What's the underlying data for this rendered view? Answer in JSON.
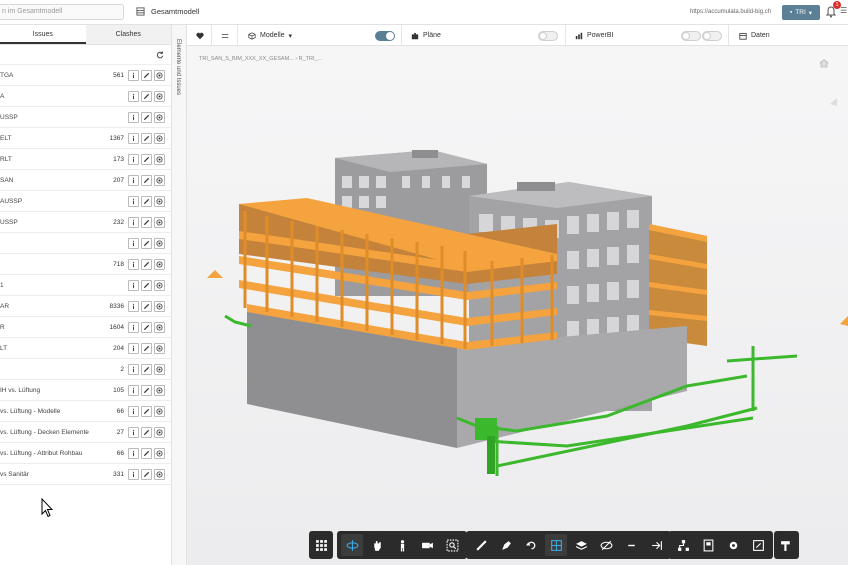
{
  "topbar": {
    "search_placeholder": "n im Gesamtmodell",
    "model_title": "Gesamtmodell",
    "url": "https://accumulata.build-big.ch",
    "user_label": "TRI",
    "notification_count": "1"
  },
  "left_panel": {
    "tabs": [
      {
        "label": "Issues",
        "active": true
      },
      {
        "label": "Clashes",
        "active": false
      }
    ],
    "rows": [
      {
        "label": "TGA",
        "count": "561"
      },
      {
        "label": "A",
        "count": ""
      },
      {
        "label": "USSP",
        "count": ""
      },
      {
        "label": "ELT",
        "count": "1367"
      },
      {
        "label": "RLT",
        "count": "173"
      },
      {
        "label": "SAN",
        "count": "207"
      },
      {
        "label": "AUSSP",
        "count": ""
      },
      {
        "label": "USSP",
        "count": "232"
      },
      {
        "label": "",
        "count": ""
      },
      {
        "label": "",
        "count": "718"
      },
      {
        "label": "1",
        "count": ""
      },
      {
        "label": "AR",
        "count": "8336"
      },
      {
        "label": "R",
        "count": "1604"
      },
      {
        "label": "LT",
        "count": "204"
      },
      {
        "label": "",
        "count": "2"
      },
      {
        "label": "IH vs. Lüftung",
        "count": "105"
      },
      {
        "label": "vs. Lüftung - Modelle",
        "count": "66"
      },
      {
        "label": "vs. Lüftung - Decken Elemente",
        "count": "27"
      },
      {
        "label": "vs. Lüftung - Attribut Rohbau",
        "count": "66"
      },
      {
        "label": "vs Sanitär",
        "count": "331"
      }
    ]
  },
  "side_tab": {
    "label": "Elemente und Issues"
  },
  "toolbar2": {
    "models_label": "Modelle",
    "plans_label": "Pläne",
    "powerbi_label": "PowerBI",
    "data_label": "Daten",
    "models_toggle_on": true,
    "plans_toggle_on": false,
    "powerbi_toggle_on": false
  },
  "viewport": {
    "breadcrumb": "TRI_SAN_S_BIM_XXX_XX_GESAM... › R_TRI_..."
  },
  "bottom_toolbar": {
    "groups": [
      [
        "grid-icon"
      ],
      [
        "orbit-icon",
        "pan-icon",
        "person-icon",
        "camera-icon",
        "zoom-box-icon"
      ],
      [
        "measure-icon",
        "markup-icon",
        "undo-icon",
        "section-icon",
        "layers-icon",
        "hide-icon",
        "minus-icon",
        "exit-icon"
      ],
      [
        "tree-icon",
        "properties-icon",
        "settings-icon",
        "fullscreen-icon"
      ],
      [
        "paint-icon"
      ]
    ]
  },
  "colors": {
    "accent": "#5b7f95",
    "orange": "#f4a33e",
    "green": "#3bb82c",
    "concrete": "#9a9a9c"
  }
}
